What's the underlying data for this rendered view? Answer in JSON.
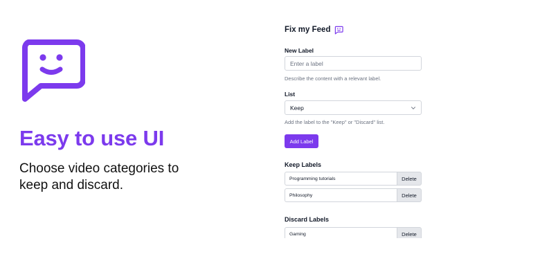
{
  "hero": {
    "logo_icon": "smiley-chat-bubble-icon",
    "headline": "Easy to use UI",
    "description": "Choose video categories to keep and discard.",
    "accent_color": "#7c3aed"
  },
  "panel": {
    "title": "Fix my Feed",
    "title_icon": "chat-bubble-icon",
    "new_label": {
      "label": "New Label",
      "value": "",
      "placeholder": "Enter a label",
      "help": "Describe the content with a relevant label."
    },
    "list": {
      "label": "List",
      "selected": "Keep",
      "help": "Add the label to the \"Keep\" or \"Discard\" list."
    },
    "add_button": "Add Label",
    "keep_section": {
      "heading": "Keep Labels",
      "items": [
        {
          "text": "Programming tutorials",
          "action": "Delete"
        },
        {
          "text": "Philosophy",
          "action": "Delete"
        }
      ]
    },
    "discard_section": {
      "heading": "Discard Labels",
      "items": [
        {
          "text": "Gaming",
          "action": "Delete"
        }
      ]
    }
  }
}
